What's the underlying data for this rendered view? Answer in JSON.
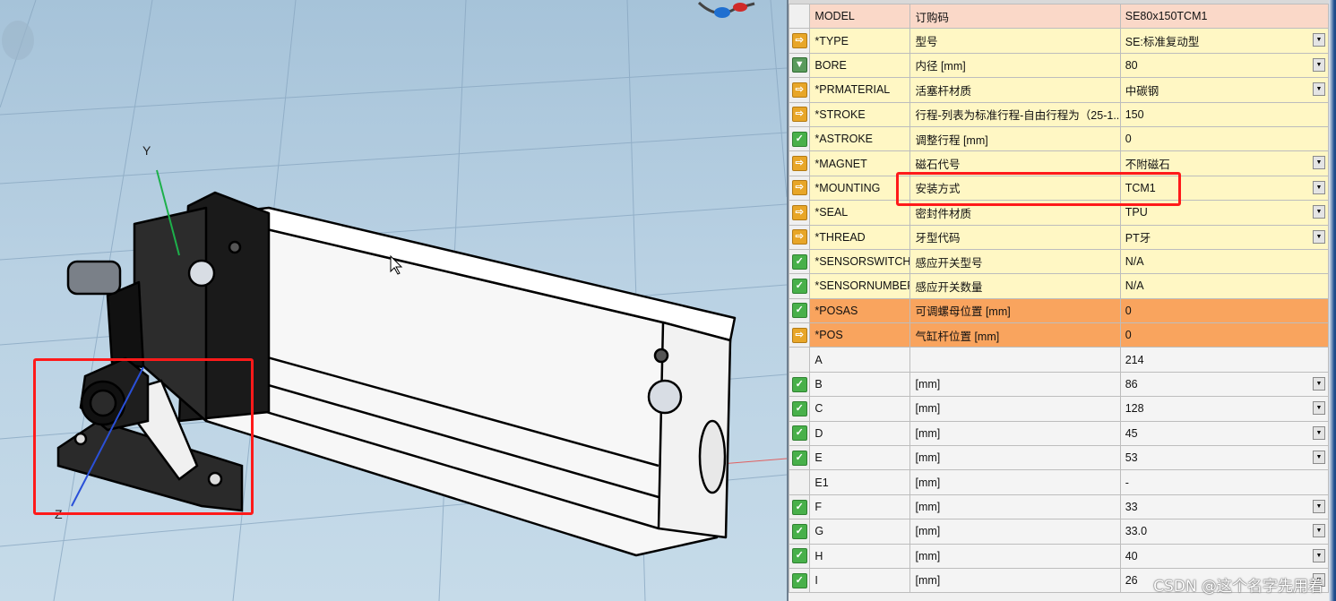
{
  "viewport": {
    "axis_y": "Y",
    "axis_z": "Z"
  },
  "table": {
    "rows": [
      {
        "icon": "none",
        "name": "MODEL",
        "desc": "订购码",
        "value": "SE80x150TCM1",
        "dropdown": false,
        "style": "salmon"
      },
      {
        "icon": "arrow-icon",
        "name": "*TYPE",
        "desc": "型号",
        "value": "SE:标准复动型",
        "dropdown": true,
        "style": "yellow"
      },
      {
        "icon": "filter-icon",
        "name": "BORE",
        "desc": "内径 [mm]",
        "value": "80",
        "dropdown": true,
        "style": "yellow"
      },
      {
        "icon": "arrow-icon",
        "name": "*PRMATERIAL",
        "desc": "活塞杆材质",
        "value": "中碳钢",
        "dropdown": true,
        "style": "yellow"
      },
      {
        "icon": "arrow-icon",
        "name": "*STROKE",
        "desc": "行程-列表为标准行程-自由行程为（25-1...",
        "value": "150",
        "dropdown": false,
        "style": "yellow"
      },
      {
        "icon": "check-icon",
        "name": "*ASTROKE",
        "desc": "调整行程 [mm]",
        "value": "0",
        "dropdown": false,
        "style": "yellow"
      },
      {
        "icon": "arrow-icon",
        "name": "*MAGNET",
        "desc": "磁石代号",
        "value": "不附磁石",
        "dropdown": true,
        "style": "yellow"
      },
      {
        "icon": "arrow-icon",
        "name": "*MOUNTING",
        "desc": "安装方式",
        "value": "TCM1",
        "dropdown": true,
        "style": "yellow"
      },
      {
        "icon": "arrow-icon",
        "name": "*SEAL",
        "desc": "密封件材质",
        "value": "TPU",
        "dropdown": true,
        "style": "yellow"
      },
      {
        "icon": "arrow-icon",
        "name": "*THREAD",
        "desc": "牙型代码",
        "value": "PT牙",
        "dropdown": true,
        "style": "yellow"
      },
      {
        "icon": "check-icon",
        "name": "*SENSORSWITCH",
        "desc": "感应开关型号",
        "value": "N/A",
        "dropdown": false,
        "style": "yellow"
      },
      {
        "icon": "check-icon",
        "name": "*SENSORNUMBER",
        "desc": "感应开关数量",
        "value": "N/A",
        "dropdown": false,
        "style": "yellow"
      },
      {
        "icon": "check-icon",
        "name": "*POSAS",
        "desc": "可调螺母位置 [mm]",
        "value": "0",
        "dropdown": false,
        "style": "orange"
      },
      {
        "icon": "arrow-icon",
        "name": "*POS",
        "desc": "气缸杆位置 [mm]",
        "value": "0",
        "dropdown": false,
        "style": "orange"
      },
      {
        "icon": "none",
        "name": "A",
        "desc": "",
        "value": "214",
        "dropdown": false,
        "style": "gray"
      },
      {
        "icon": "check-icon",
        "name": "B",
        "desc": "[mm]",
        "value": "86",
        "dropdown": true,
        "style": "gray"
      },
      {
        "icon": "check-icon",
        "name": "C",
        "desc": "[mm]",
        "value": "128",
        "dropdown": true,
        "style": "gray"
      },
      {
        "icon": "check-icon",
        "name": "D",
        "desc": "[mm]",
        "value": "45",
        "dropdown": true,
        "style": "gray"
      },
      {
        "icon": "check-icon",
        "name": "E",
        "desc": "[mm]",
        "value": "53",
        "dropdown": true,
        "style": "gray"
      },
      {
        "icon": "none",
        "name": "E1",
        "desc": "[mm]",
        "value": "-",
        "dropdown": false,
        "style": "gray"
      },
      {
        "icon": "check-icon",
        "name": "F",
        "desc": "[mm]",
        "value": "33",
        "dropdown": true,
        "style": "gray"
      },
      {
        "icon": "check-icon",
        "name": "G",
        "desc": "[mm]",
        "value": "33.0",
        "dropdown": true,
        "style": "gray"
      },
      {
        "icon": "check-icon",
        "name": "H",
        "desc": "[mm]",
        "value": "40",
        "dropdown": true,
        "style": "gray"
      },
      {
        "icon": "check-icon",
        "name": "I",
        "desc": "[mm]",
        "value": "26",
        "dropdown": true,
        "style": "gray"
      }
    ]
  },
  "highlight_color": "#ff1a1a",
  "watermark": "CSDN @这个名字先用着"
}
